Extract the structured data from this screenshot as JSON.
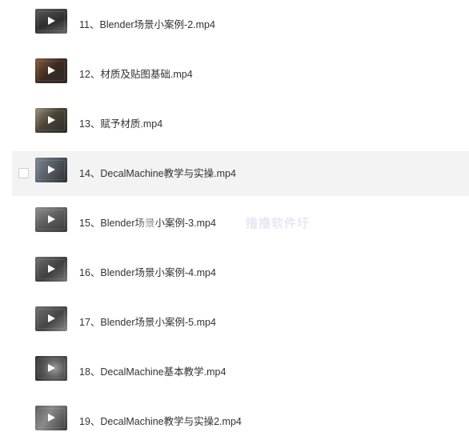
{
  "files": [
    {
      "name": "11、Blender场景小案例-2.mp4",
      "thumbnail_icon": "play-icon"
    },
    {
      "name": "12、材质及贴图基础.mp4",
      "thumbnail_icon": "play-icon"
    },
    {
      "name": "13、赋予材质.mp4",
      "thumbnail_icon": "play-icon"
    },
    {
      "name": "14、DecalMachine教学与实操.mp4",
      "thumbnail_icon": "play-icon",
      "hovered": true,
      "checked": false
    },
    {
      "name": "15、Blender场景小案例-3.mp4",
      "thumbnail_icon": "play-icon"
    },
    {
      "name": "16、Blender场景小案例-4.mp4",
      "thumbnail_icon": "play-icon"
    },
    {
      "name": "17、Blender场景小案例-5.mp4",
      "thumbnail_icon": "play-icon"
    },
    {
      "name": "18、DecalMachine基本教学.mp4",
      "thumbnail_icon": "play-icon"
    },
    {
      "name": "19、DecalMachine教学与实操2.mp4",
      "thumbnail_icon": "play-icon"
    }
  ],
  "watermark": {
    "text": "撸撸软件圩"
  },
  "colors": {
    "hover_background": "#f3f3f3",
    "text": "#333333",
    "checkbox_border": "#cfcfcf",
    "watermark": "#e6e9f4"
  }
}
